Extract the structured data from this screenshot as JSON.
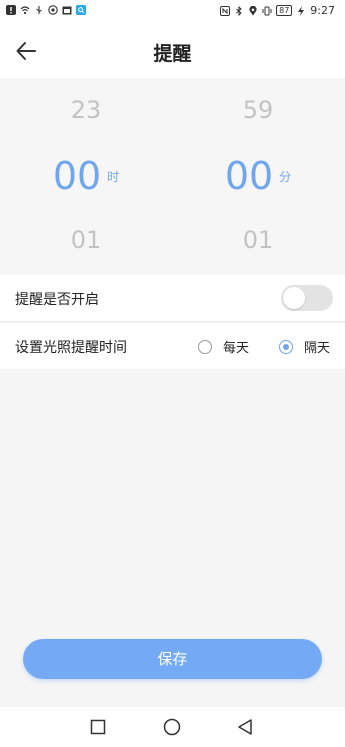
{
  "status_bar": {
    "battery": "87",
    "time": "9:27"
  },
  "header": {
    "title": "提醒"
  },
  "picker": {
    "hour": {
      "prev": "23",
      "current": "00",
      "next": "01",
      "unit": "时"
    },
    "minute": {
      "prev": "59",
      "current": "00",
      "next": "01",
      "unit": "分"
    }
  },
  "settings": {
    "reminder_label": "提醒是否开启",
    "reminder_enabled": false,
    "light_time_label": "设置光照提醒时间",
    "options": [
      {
        "label": "每天",
        "selected": false
      },
      {
        "label": "隔天",
        "selected": true
      }
    ]
  },
  "actions": {
    "save_label": "保存"
  },
  "colors": {
    "accent": "#6fa6ee",
    "button": "#74aaf5",
    "toggle_off": "#e3e3e3"
  },
  "icons": {
    "back": "arrow-left-icon",
    "nav_recent": "square-icon",
    "nav_home": "circle-icon",
    "nav_back": "triangle-back-icon"
  }
}
